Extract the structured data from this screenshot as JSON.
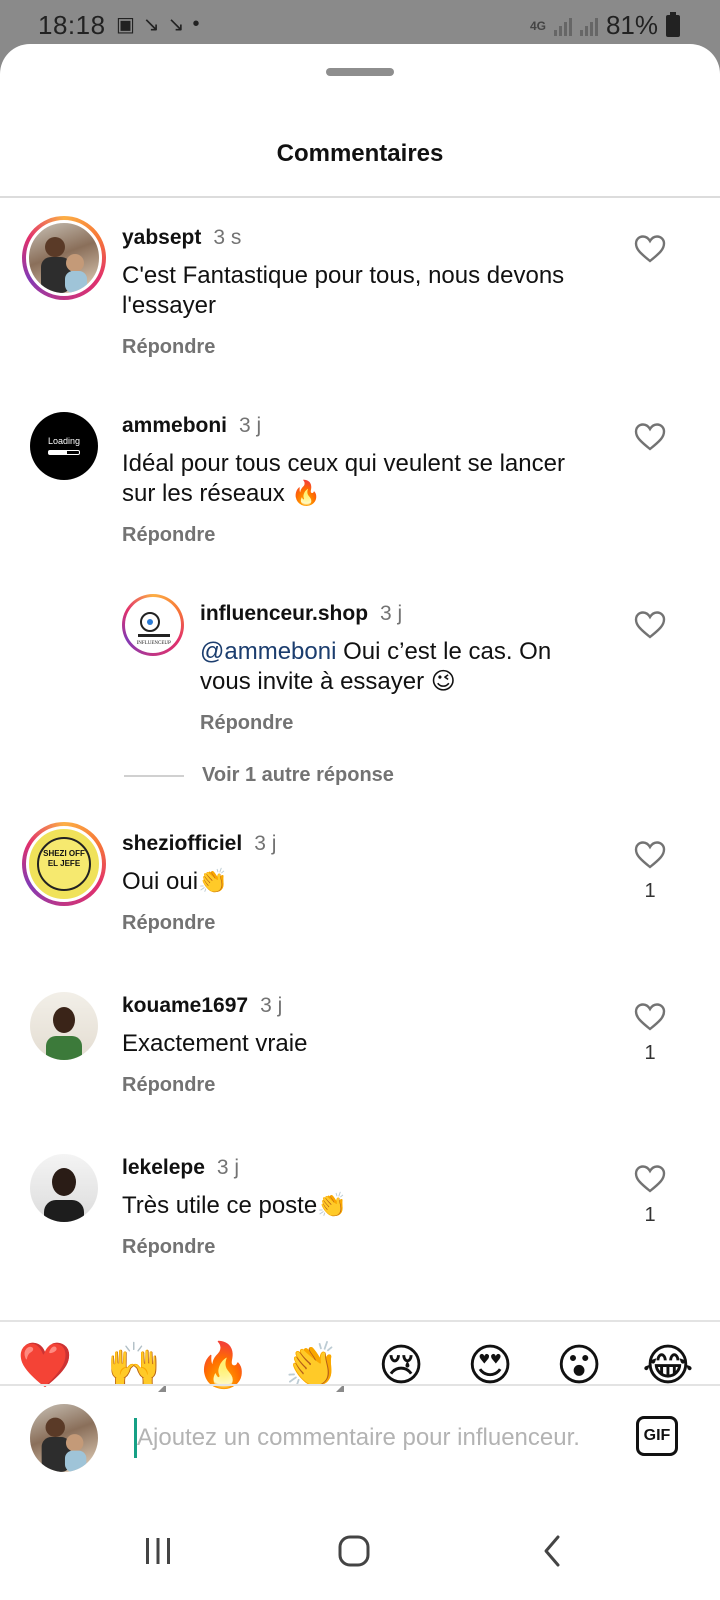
{
  "status_bar": {
    "time": "18:18",
    "network": "4G",
    "battery": "81%"
  },
  "sheet": {
    "title": "Commentaires"
  },
  "comments": [
    {
      "username": "yabsept",
      "time": "3 s",
      "text": "C'est Fantastique pour tous, nous devons l'essayer",
      "reply_label": "Répondre",
      "likes": ""
    },
    {
      "username": "ammeboni",
      "time": "3 j",
      "text": "Idéal pour tous ceux qui veulent se lancer sur les réseaux 🔥",
      "reply_label": "Répondre",
      "likes": "",
      "avatar_text": "Loading"
    },
    {
      "username": "influenceur.shop",
      "time": "3 j",
      "mention": "@ammeboni",
      "text": " Oui c’est le cas. On vous invite à essayer 😉",
      "reply_label": "Répondre",
      "likes": "",
      "is_reply": true
    },
    {
      "username": "sheziofficiel",
      "time": "3 j",
      "text": "Oui oui👏",
      "reply_label": "Répondre",
      "likes": "1",
      "avatar_text": "SHEZI OFF EL JEFE"
    },
    {
      "username": "kouame1697",
      "time": "3 j",
      "text": "Exactement vraie",
      "reply_label": "Répondre",
      "likes": "1"
    },
    {
      "username": "lekelepe",
      "time": "3 j",
      "text": "Très utile ce poste👏",
      "reply_label": "Répondre",
      "likes": "1"
    }
  ],
  "view_more": "Voir 1 autre réponse",
  "emoji_bar": [
    "❤️",
    "🙌",
    "🔥",
    "👏",
    "😢",
    "😍",
    "😮",
    "😂"
  ],
  "input": {
    "placeholder": "Ajoutez un commentaire pour influenceur.",
    "value": "",
    "gif_label": "GIF"
  },
  "icons": {
    "like": "heart-outline-icon",
    "recent_apps": "recent-apps-icon",
    "home": "home-icon",
    "back": "back-icon"
  },
  "colors": {
    "story_ring": [
      "#fcaf45",
      "#e1306c",
      "#833ab4"
    ],
    "mention": "#1b3d6e",
    "muted": "#737373"
  }
}
